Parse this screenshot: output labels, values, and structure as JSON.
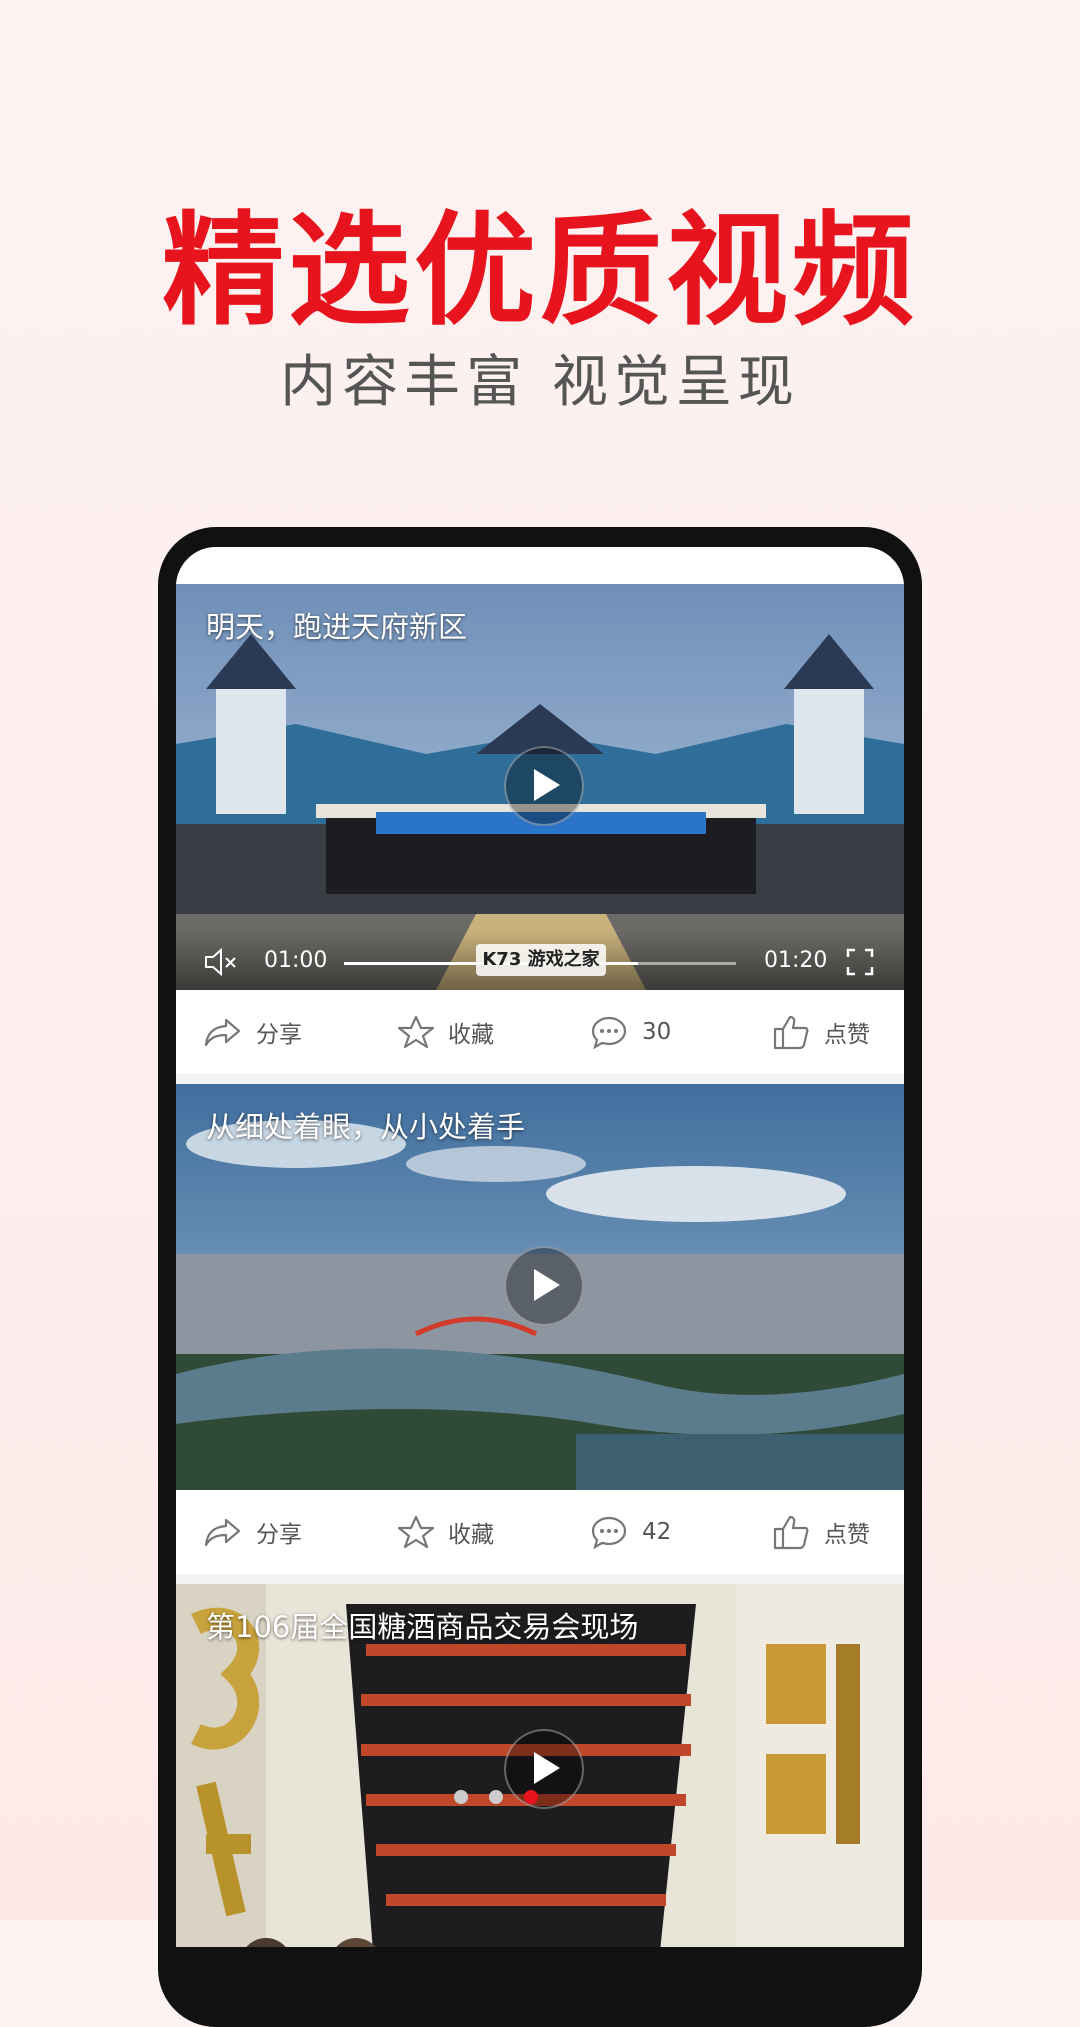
{
  "promo": {
    "headline": "精选优质视频",
    "subline": "内容丰富 视觉呈现"
  },
  "colors": {
    "accent": "#e8141d"
  },
  "feed": [
    {
      "title": "明天，跑进天府新区",
      "current_time": "01:00",
      "duration": "01:20",
      "progress": 0.75,
      "share_label": "分享",
      "favorite_label": "收藏",
      "comment_count": "30",
      "like_label": "点赞",
      "watermark": "K73 游戏之家"
    },
    {
      "title": "从细处着眼，从小处着手",
      "share_label": "分享",
      "favorite_label": "收藏",
      "comment_count": "42",
      "like_label": "点赞"
    },
    {
      "title": "第106届全国糖酒商品交易会现场"
    }
  ]
}
